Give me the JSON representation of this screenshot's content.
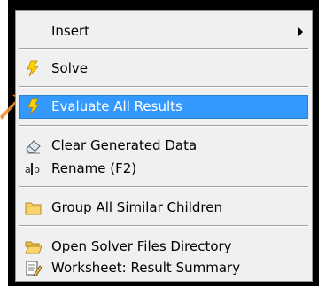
{
  "menu": {
    "items": [
      {
        "label": "Insert",
        "icon": "none",
        "submenu": true
      },
      {
        "label": "Solve",
        "icon": "lightning-icon"
      },
      {
        "label": "Evaluate All Results",
        "icon": "lightning-icon",
        "highlighted": true
      },
      {
        "label": "Clear Generated Data",
        "icon": "eraser-icon"
      },
      {
        "label": "Rename (F2)",
        "icon": "rename-icon"
      },
      {
        "label": "Group All Similar Children",
        "icon": "folder-icon"
      },
      {
        "label": "Open Solver Files Directory",
        "icon": "open-folder-icon"
      },
      {
        "label": "Worksheet: Result Summary",
        "icon": "worksheet-icon"
      }
    ]
  },
  "colors": {
    "highlight": "#3399ff",
    "menu_bg": "#f0f0f0",
    "frame": "#000000",
    "pointer": "#f08a34"
  }
}
